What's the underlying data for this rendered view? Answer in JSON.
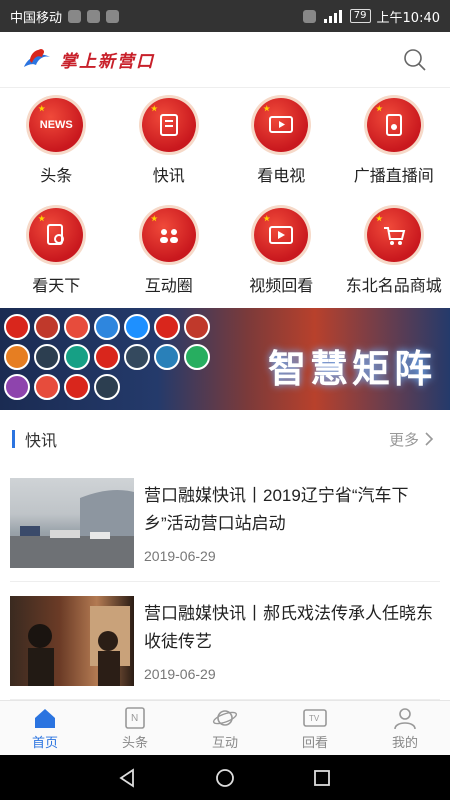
{
  "statusbar": {
    "carrier": "中国移动",
    "battery": "79",
    "time": "上午10:40"
  },
  "header": {
    "app_name": "掌上新营口"
  },
  "grid": [
    {
      "label": "头条",
      "glyph": "NEWS"
    },
    {
      "label": "快讯",
      "glyph": ""
    },
    {
      "label": "看电视",
      "glyph": ""
    },
    {
      "label": "广播直播间",
      "glyph": ""
    },
    {
      "label": "看天下",
      "glyph": ""
    },
    {
      "label": "互动圈",
      "glyph": ""
    },
    {
      "label": "视频回看",
      "glyph": ""
    },
    {
      "label": "东北名品商城",
      "glyph": ""
    }
  ],
  "banner": {
    "title": "智慧矩阵"
  },
  "section": {
    "title": "快讯",
    "more": "更多"
  },
  "news": [
    {
      "title": "营口融媒快讯丨2019辽宁省“汽车下乡”活动营口站启动",
      "date": "2019-06-29"
    },
    {
      "title": "营口融媒快讯丨郝氏戏法传承人任晓东收徒传艺",
      "date": "2019-06-29"
    }
  ],
  "tabs": [
    {
      "label": "首页",
      "icon": "home-icon"
    },
    {
      "label": "头条",
      "icon": "news-icon"
    },
    {
      "label": "互动",
      "icon": "planet-icon"
    },
    {
      "label": "回看",
      "icon": "tv-icon"
    },
    {
      "label": "我的",
      "icon": "user-icon"
    }
  ],
  "colors": {
    "accent": "#2b74e0",
    "brand_red": "#c9181e"
  }
}
